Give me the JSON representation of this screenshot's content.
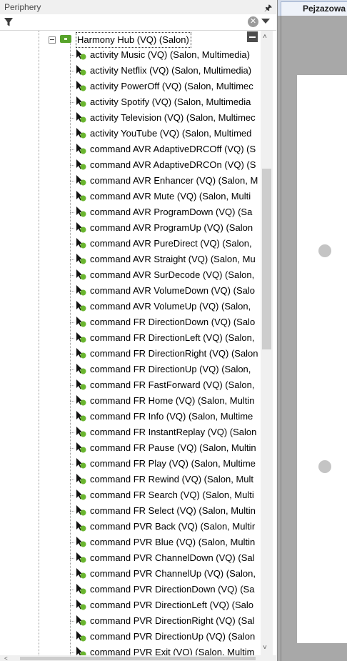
{
  "panel": {
    "title": "Periphery",
    "pin_icon": "pin-icon",
    "filter": {
      "value": "",
      "placeholder": ""
    }
  },
  "tree": {
    "parent": {
      "label": "Harmony Hub (VQ) (Salon)",
      "expanded": true,
      "icon": "harmony-hub-icon"
    },
    "children": [
      {
        "label": "activity Music (VQ) (Salon, Multimedia)"
      },
      {
        "label": "activity Netflix (VQ) (Salon, Multimedia)"
      },
      {
        "label": "activity PowerOff (VQ) (Salon, Multimec"
      },
      {
        "label": "activity Spotify (VQ) (Salon, Multimedia"
      },
      {
        "label": "activity Television (VQ) (Salon, Multimec"
      },
      {
        "label": "activity YouTube (VQ) (Salon, Multimed"
      },
      {
        "label": "command AVR AdaptiveDRCOff (VQ) (S"
      },
      {
        "label": "command AVR AdaptiveDRCOn (VQ) (S"
      },
      {
        "label": "command AVR Enhancer (VQ) (Salon, M"
      },
      {
        "label": "command AVR Mute (VQ) (Salon, Multi"
      },
      {
        "label": "command AVR ProgramDown (VQ) (Sa"
      },
      {
        "label": "command AVR ProgramUp (VQ) (Salon"
      },
      {
        "label": "command AVR PureDirect (VQ) (Salon,"
      },
      {
        "label": "command AVR Straight (VQ) (Salon, Mu"
      },
      {
        "label": "command AVR SurDecode (VQ) (Salon,"
      },
      {
        "label": "command AVR VolumeDown (VQ) (Salo"
      },
      {
        "label": "command AVR VolumeUp (VQ) (Salon,"
      },
      {
        "label": "command FR DirectionDown (VQ) (Salo"
      },
      {
        "label": "command FR DirectionLeft (VQ) (Salon,"
      },
      {
        "label": "command FR DirectionRight (VQ) (Salon"
      },
      {
        "label": "command FR DirectionUp (VQ) (Salon,"
      },
      {
        "label": "command FR FastForward (VQ) (Salon,"
      },
      {
        "label": "command FR Home (VQ) (Salon, Multin"
      },
      {
        "label": "command FR Info (VQ) (Salon, Multime"
      },
      {
        "label": "command FR InstantReplay (VQ) (Salon"
      },
      {
        "label": "command FR Pause (VQ) (Salon, Multin"
      },
      {
        "label": "command FR Play (VQ) (Salon, Multime"
      },
      {
        "label": "command FR Rewind (VQ) (Salon, Mult"
      },
      {
        "label": "command FR Search (VQ) (Salon, Multi"
      },
      {
        "label": "command FR Select (VQ) (Salon, Multin"
      },
      {
        "label": "command PVR Back (VQ) (Salon, Multir"
      },
      {
        "label": "command PVR Blue (VQ) (Salon, Multin"
      },
      {
        "label": "command PVR ChannelDown (VQ) (Sal"
      },
      {
        "label": "command PVR ChannelUp (VQ) (Salon,"
      },
      {
        "label": "command PVR DirectionDown (VQ) (Sa"
      },
      {
        "label": "command PVR DirectionLeft (VQ) (Salo"
      },
      {
        "label": "command PVR DirectionRight (VQ) (Sal"
      },
      {
        "label": "command PVR DirectionUp (VQ) (Salon"
      },
      {
        "label": "command PVR Exit (VQ) (Salon, Multim"
      }
    ],
    "child_icon": "activity-node-icon"
  },
  "tabs": [
    {
      "label": "Pejzazowa",
      "active": true
    }
  ],
  "colors": {
    "accent_green": "#57a32b",
    "tab_active": "#eef2f9",
    "canvas_background": "#a8a8a8"
  }
}
